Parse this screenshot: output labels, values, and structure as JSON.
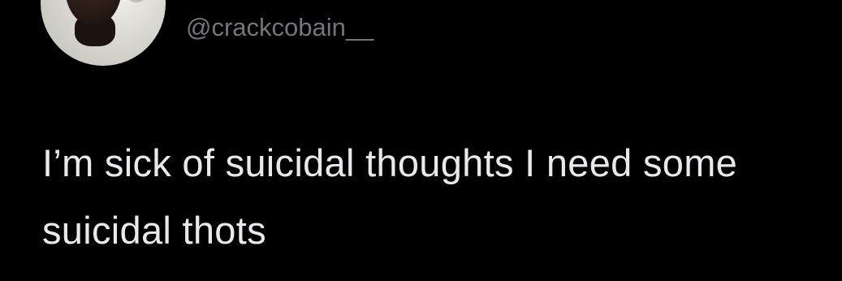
{
  "tweet": {
    "avatar_icon": "profile-avatar",
    "handle": "@crackcobain__",
    "text": "I’m sick of suicidal thoughts I need some suicidal thots"
  },
  "colors": {
    "background": "#000000",
    "handle": "#71767b",
    "text": "#e7e9ea"
  }
}
